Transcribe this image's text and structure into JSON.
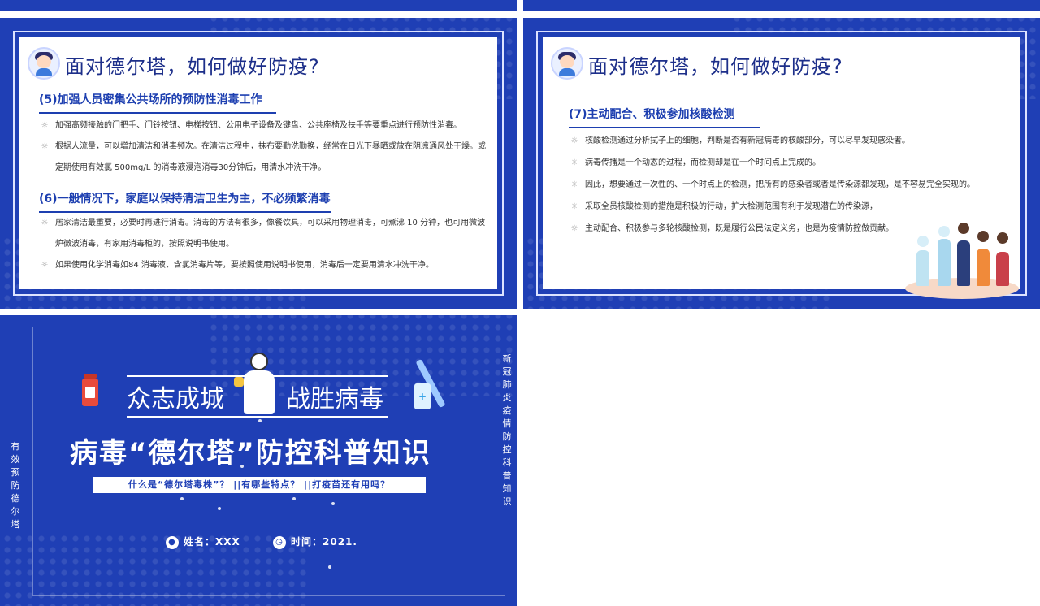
{
  "slide1": {
    "title": "面对德尔塔，如何做好防疫?",
    "section5": {
      "heading": "(5)加强人员密集公共场所的预防性消毒工作",
      "bullets": [
        "加强高频接触的门把手、门铃按钮、电梯按钮、公用电子设备及键盘、公共座椅及扶手等要重点进行预防性消毒。",
        "根据人流量，可以增加清洁和消毒频次。在清洁过程中，抹布要勤洗勤换，经常在日光下暴晒或放在阴凉通风处干燥。或定期使用有效氯 500mg/L 的消毒液浸泡消毒30分钟后，用清水冲洗干净。"
      ]
    },
    "section6": {
      "heading": "(6)一般情况下，家庭以保持清洁卫生为主，不必频繁消毒",
      "bullets": [
        "居家清洁最重要，必要时再进行消毒。消毒的方法有很多，像餐饮具，可以采用物理消毒，可煮沸 10 分钟，也可用微波炉微波消毒，有家用消毒柜的，按照说明书使用。",
        "如果使用化学消毒如84 消毒液、含氯消毒片等，要按照使用说明书使用，消毒后一定要用清水冲洗干净。"
      ]
    }
  },
  "slide2": {
    "title": "面对德尔塔，如何做好防疫?",
    "section7": {
      "heading": "(7)主动配合、积极参加核酸检测",
      "bullets": [
        "核酸检测通过分析拭子上的细胞，判断是否有新冠病毒的核酸部分，可以尽早发现感染者。",
        "病毒传播是一个动态的过程，而检测却是在一个时间点上完成的。",
        "因此，想要通过一次性的、一个时点上的检测，把所有的感染者或者是传染源都发现，是不容易完全实现的。",
        "采取全员核酸检测的措施是积极的行动，扩大检测范围有利于发现潜在的传染源，",
        "主动配合、积极参与多轮核酸检测，既是履行公民法定义务，也是为疫情防控做贡献。"
      ]
    }
  },
  "cover": {
    "banner_left": "众志成城",
    "banner_right": "战胜病毒",
    "main_title": "病毒“德尔塔”防控科普知识",
    "subtitle": "什么是“德尔塔毒株”？ ||有哪些特点？ ||打疫苗还有用吗？",
    "vertical_left": "有效预防德尔塔",
    "vertical_right": "新冠肺炎疫情防控科普知识",
    "name_label": "姓名：XXX",
    "time_label": "时间：2021."
  },
  "bullet_icon": "☼",
  "colors": {
    "brand_blue": "#1f3fb5",
    "title_blue": "#1d2f8a"
  }
}
